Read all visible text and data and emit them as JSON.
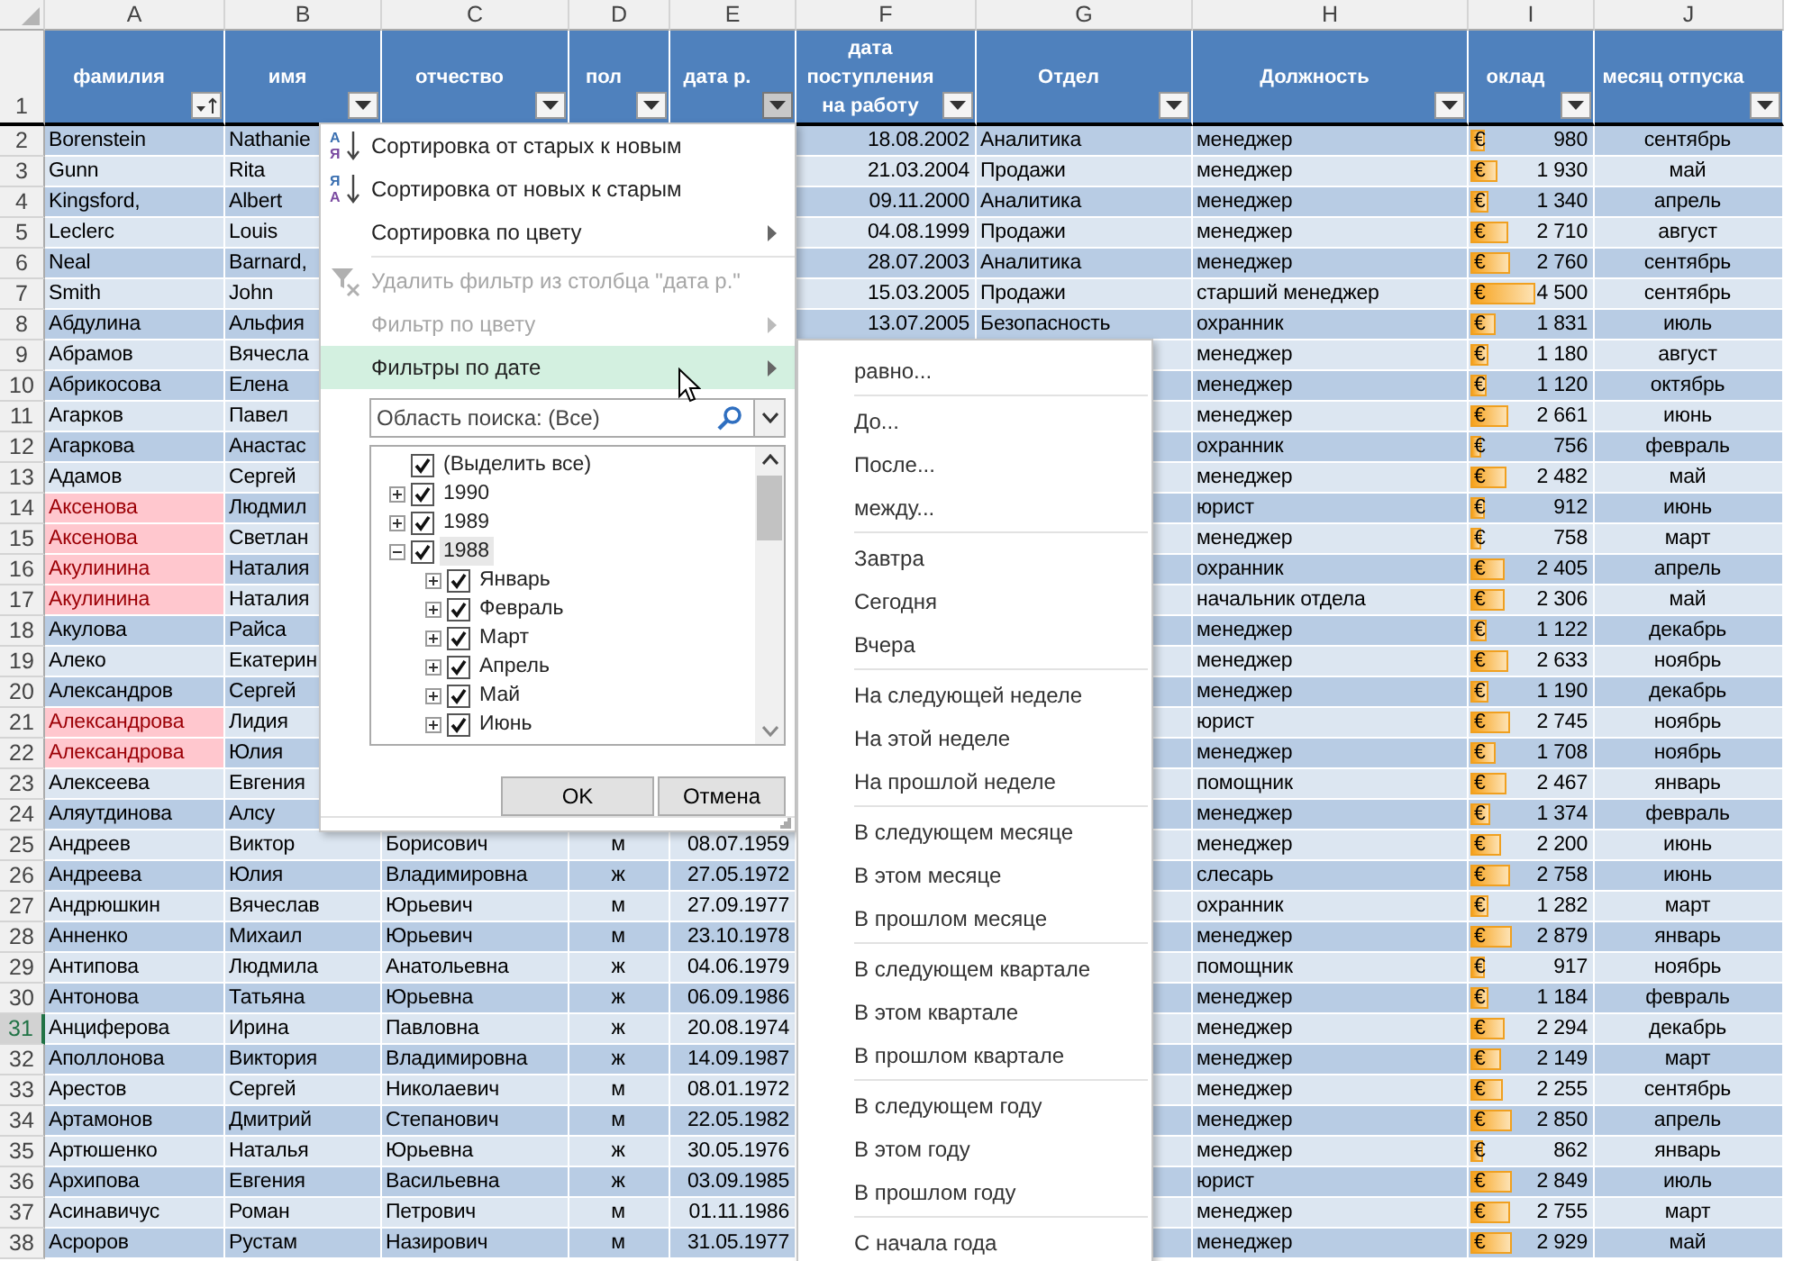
{
  "columns": [
    {
      "letter": "A",
      "header": "фамилия",
      "sorted": true,
      "open": false
    },
    {
      "letter": "B",
      "header": "имя",
      "sorted": false,
      "open": false
    },
    {
      "letter": "C",
      "header": "отчество",
      "sorted": false,
      "open": false
    },
    {
      "letter": "D",
      "header": "пол",
      "sorted": false,
      "open": false
    },
    {
      "letter": "E",
      "header": "дата р.",
      "sorted": false,
      "open": true
    },
    {
      "letter": "F",
      "header": "дата поступления на работу",
      "sorted": false,
      "open": false
    },
    {
      "letter": "G",
      "header": "Отдел",
      "sorted": false,
      "open": false
    },
    {
      "letter": "H",
      "header": "Должность",
      "sorted": false,
      "open": false
    },
    {
      "letter": "I",
      "header": "оклад",
      "sorted": false,
      "open": false
    },
    {
      "letter": "J",
      "header": "месяц отпуска",
      "sorted": false,
      "open": false
    }
  ],
  "header_row_number": "1",
  "rows": [
    {
      "number": "2",
      "active": false,
      "cells": {
        "surname": {
          "text": "Borenstein",
          "highlighted": false
        },
        "name": "Nathanie",
        "hire_date": "18.08.2002",
        "department": "Аналитика",
        "position": "менеджер",
        "salary": {
          "currency": "€",
          "amount": "980",
          "level": 0.11
        },
        "vacation_month": "сентябрь"
      }
    },
    {
      "number": "3",
      "active": false,
      "cells": {
        "surname": {
          "text": "Gunn",
          "highlighted": false
        },
        "name": "Rita",
        "hire_date": "21.03.2004",
        "department": "Продажи",
        "position": "менеджер",
        "salary": {
          "currency": "€",
          "amount": "1 930",
          "level": 0.22
        },
        "vacation_month": "май"
      }
    },
    {
      "number": "4",
      "active": false,
      "cells": {
        "surname": {
          "text": "Kingsford,",
          "highlighted": false
        },
        "name": "Albert",
        "hire_date": "09.11.2000",
        "department": "Аналитика",
        "position": "менеджер",
        "salary": {
          "currency": "€",
          "amount": "1 340",
          "level": 0.15
        },
        "vacation_month": "апрель"
      }
    },
    {
      "number": "5",
      "active": false,
      "cells": {
        "surname": {
          "text": "Leclerc",
          "highlighted": false
        },
        "name": "Louis",
        "hire_date": "04.08.1999",
        "department": "Продажи",
        "position": "менеджер",
        "salary": {
          "currency": "€",
          "amount": "2 710",
          "level": 0.31
        },
        "vacation_month": "август"
      }
    },
    {
      "number": "6",
      "active": false,
      "cells": {
        "surname": {
          "text": "Neal",
          "highlighted": false
        },
        "name": "Barnard,",
        "hire_date": "28.07.2003",
        "department": "Аналитика",
        "position": "менеджер",
        "salary": {
          "currency": "€",
          "amount": "2 760",
          "level": 0.32
        },
        "vacation_month": "сентябрь"
      }
    },
    {
      "number": "7",
      "active": false,
      "cells": {
        "surname": {
          "text": "Smith",
          "highlighted": false
        },
        "name": "John",
        "hire_date": "15.03.2005",
        "department": "Продажи",
        "position": "старший менеджер",
        "salary": {
          "currency": "€",
          "amount": "4 500",
          "level": 0.52
        },
        "vacation_month": "сентябрь"
      }
    },
    {
      "number": "8",
      "active": false,
      "cells": {
        "surname": {
          "text": "Абдулина",
          "highlighted": false
        },
        "name": "Альфия",
        "hire_date": "13.07.2005",
        "department": "Безопасность",
        "position": "охранник",
        "salary": {
          "currency": "€",
          "amount": "1 831",
          "level": 0.21
        },
        "vacation_month": "июль"
      }
    },
    {
      "number": "9",
      "active": false,
      "cells": {
        "surname": {
          "text": "Абрамов",
          "highlighted": false
        },
        "name": "Вячесла",
        "position": "менеджер",
        "salary": {
          "currency": "€",
          "amount": "1 180",
          "level": 0.14
        },
        "vacation_month": "август"
      }
    },
    {
      "number": "10",
      "active": false,
      "cells": {
        "surname": {
          "text": "Абрикосова",
          "highlighted": false
        },
        "name": "Елена",
        "position": "менеджер",
        "salary": {
          "currency": "€",
          "amount": "1 120",
          "level": 0.13
        },
        "vacation_month": "октябрь"
      }
    },
    {
      "number": "11",
      "active": false,
      "cells": {
        "surname": {
          "text": "Агарков",
          "highlighted": false
        },
        "name": "Павел",
        "position": "менеджер",
        "salary": {
          "currency": "€",
          "amount": "2 661",
          "level": 0.31
        },
        "vacation_month": "июнь"
      }
    },
    {
      "number": "12",
      "active": false,
      "cells": {
        "surname": {
          "text": "Агаркова",
          "highlighted": false
        },
        "name": "Анастас",
        "position": "охранник",
        "salary": {
          "currency": "€",
          "amount": "756",
          "level": 0.09
        },
        "vacation_month": "февраль"
      }
    },
    {
      "number": "13",
      "active": false,
      "cells": {
        "surname": {
          "text": "Адамов",
          "highlighted": false
        },
        "name": "Сергей",
        "position": "менеджер",
        "salary": {
          "currency": "€",
          "amount": "2 482",
          "level": 0.29
        },
        "vacation_month": "май"
      }
    },
    {
      "number": "14",
      "active": false,
      "cells": {
        "surname": {
          "text": "Аксенова",
          "highlighted": true
        },
        "name": "Людмил",
        "position": "юрист",
        "salary": {
          "currency": "€",
          "amount": "912",
          "level": 0.11
        },
        "vacation_month": "июнь"
      }
    },
    {
      "number": "15",
      "active": false,
      "cells": {
        "surname": {
          "text": "Аксенова",
          "highlighted": true
        },
        "name": "Светлан",
        "position": "менеджер",
        "salary": {
          "currency": "€",
          "amount": "758",
          "level": 0.09
        },
        "vacation_month": "март"
      }
    },
    {
      "number": "16",
      "active": false,
      "cells": {
        "surname": {
          "text": "Акулинина",
          "highlighted": true
        },
        "name": "Наталия",
        "position": "охранник",
        "salary": {
          "currency": "€",
          "amount": "2 405",
          "level": 0.28
        },
        "vacation_month": "апрель"
      }
    },
    {
      "number": "17",
      "active": false,
      "cells": {
        "surname": {
          "text": "Акулинина",
          "highlighted": true
        },
        "name": "Наталия",
        "position": "начальник отдела",
        "salary": {
          "currency": "€",
          "amount": "2 306",
          "level": 0.27
        },
        "vacation_month": "май"
      }
    },
    {
      "number": "18",
      "active": false,
      "cells": {
        "surname": {
          "text": "Акулова",
          "highlighted": false
        },
        "name": "Райса",
        "position": "менеджер",
        "salary": {
          "currency": "€",
          "amount": "1 122",
          "level": 0.13
        },
        "vacation_month": "декабрь"
      }
    },
    {
      "number": "19",
      "active": false,
      "cells": {
        "surname": {
          "text": "Алеко",
          "highlighted": false
        },
        "name": "Екатерин",
        "position": "менеджер",
        "salary": {
          "currency": "€",
          "amount": "2 633",
          "level": 0.3
        },
        "vacation_month": "ноябрь"
      }
    },
    {
      "number": "20",
      "active": false,
      "cells": {
        "surname": {
          "text": "Александров",
          "highlighted": false
        },
        "name": "Сергей",
        "position": "менеджер",
        "salary": {
          "currency": "€",
          "amount": "1 190",
          "level": 0.14
        },
        "vacation_month": "декабрь"
      }
    },
    {
      "number": "21",
      "active": false,
      "cells": {
        "surname": {
          "text": "Александрова",
          "highlighted": true
        },
        "name": "Лидия",
        "position": "юрист",
        "salary": {
          "currency": "€",
          "amount": "2 745",
          "level": 0.32
        },
        "vacation_month": "ноябрь"
      }
    },
    {
      "number": "22",
      "active": false,
      "cells": {
        "surname": {
          "text": "Александрова",
          "highlighted": true
        },
        "name": "Юлия",
        "position": "менеджер",
        "salary": {
          "currency": "€",
          "amount": "1 708",
          "level": 0.2
        },
        "vacation_month": "ноябрь"
      }
    },
    {
      "number": "23",
      "active": false,
      "cells": {
        "surname": {
          "text": "Алексеева",
          "highlighted": false
        },
        "name": "Евгения",
        "position": "помощник",
        "salary": {
          "currency": "€",
          "amount": "2 467",
          "level": 0.29
        },
        "vacation_month": "январь"
      }
    },
    {
      "number": "24",
      "active": false,
      "cells": {
        "surname": {
          "text": "Аляутдинова",
          "highlighted": false
        },
        "name": "Алсу",
        "position": "менеджер",
        "salary": {
          "currency": "€",
          "amount": "1 374",
          "level": 0.16
        },
        "vacation_month": "февраль"
      }
    },
    {
      "number": "25",
      "active": false,
      "cells": {
        "surname": {
          "text": "Андреев",
          "highlighted": false
        },
        "name": "Виктор",
        "patronymic": "Борисович",
        "gender": "м",
        "birth_date": "08.07.1959",
        "position": "менеджер",
        "salary": {
          "currency": "€",
          "amount": "2 200",
          "level": 0.25
        },
        "vacation_month": "июнь"
      }
    },
    {
      "number": "26",
      "active": false,
      "cells": {
        "surname": {
          "text": "Андреева",
          "highlighted": false
        },
        "name": "Юлия",
        "patronymic": "Владимировна",
        "gender": "ж",
        "birth_date": "27.05.1972",
        "position": "слесарь",
        "salary": {
          "currency": "€",
          "amount": "2 758",
          "level": 0.32
        },
        "vacation_month": "июнь"
      }
    },
    {
      "number": "27",
      "active": false,
      "cells": {
        "surname": {
          "text": "Андрюшкин",
          "highlighted": false
        },
        "name": "Вячеслав",
        "patronymic": "Юрьевич",
        "gender": "м",
        "birth_date": "27.09.1977",
        "position": "охранник",
        "salary": {
          "currency": "€",
          "amount": "1 282",
          "level": 0.15
        },
        "vacation_month": "март"
      }
    },
    {
      "number": "28",
      "active": false,
      "cells": {
        "surname": {
          "text": "Анненко",
          "highlighted": false
        },
        "name": "Михаил",
        "patronymic": "Юрьевич",
        "gender": "м",
        "birth_date": "23.10.1978",
        "position": "менеджер",
        "salary": {
          "currency": "€",
          "amount": "2 879",
          "level": 0.33
        },
        "vacation_month": "январь"
      }
    },
    {
      "number": "29",
      "active": false,
      "cells": {
        "surname": {
          "text": "Антипова",
          "highlighted": false
        },
        "name": "Людмила",
        "patronymic": "Анатольевна",
        "gender": "ж",
        "birth_date": "04.06.1979",
        "position": "помощник",
        "salary": {
          "currency": "€",
          "amount": "917",
          "level": 0.11
        },
        "vacation_month": "ноябрь"
      }
    },
    {
      "number": "30",
      "active": false,
      "cells": {
        "surname": {
          "text": "Антонова",
          "highlighted": false
        },
        "name": "Татьяна",
        "patronymic": "Юрьевна",
        "gender": "ж",
        "birth_date": "06.09.1986",
        "position": "менеджер",
        "salary": {
          "currency": "€",
          "amount": "1 184",
          "level": 0.14
        },
        "vacation_month": "февраль"
      }
    },
    {
      "number": "31",
      "active": true,
      "cells": {
        "surname": {
          "text": "Анциферова",
          "highlighted": false
        },
        "name": "Ирина",
        "patronymic": "Павловна",
        "gender": "ж",
        "birth_date": "20.08.1974",
        "position": "менеджер",
        "salary": {
          "currency": "€",
          "amount": "2 294",
          "level": 0.27
        },
        "vacation_month": "декабрь"
      }
    },
    {
      "number": "32",
      "active": false,
      "cells": {
        "surname": {
          "text": "Аполлонова",
          "highlighted": false
        },
        "name": "Виктория",
        "patronymic": "Владимировна",
        "gender": "ж",
        "birth_date": "14.09.1987",
        "position": "менеджер",
        "salary": {
          "currency": "€",
          "amount": "2 149",
          "level": 0.25
        },
        "vacation_month": "март"
      }
    },
    {
      "number": "33",
      "active": false,
      "cells": {
        "surname": {
          "text": "Арестов",
          "highlighted": false
        },
        "name": "Сергей",
        "patronymic": "Николаевич",
        "gender": "м",
        "birth_date": "08.01.1972",
        "position": "менеджер",
        "salary": {
          "currency": "€",
          "amount": "2 255",
          "level": 0.26
        },
        "vacation_month": "сентябрь"
      }
    },
    {
      "number": "34",
      "active": false,
      "cells": {
        "surname": {
          "text": "Артамонов",
          "highlighted": false
        },
        "name": "Дмитрий",
        "patronymic": "Степанович",
        "gender": "м",
        "birth_date": "22.05.1982",
        "position": "менеджер",
        "salary": {
          "currency": "€",
          "amount": "2 850",
          "level": 0.33
        },
        "vacation_month": "апрель"
      }
    },
    {
      "number": "35",
      "active": false,
      "cells": {
        "surname": {
          "text": "Артюшенко",
          "highlighted": false
        },
        "name": "Наталья",
        "patronymic": "Юрьевна",
        "gender": "ж",
        "birth_date": "30.05.1976",
        "position": "менеджер",
        "salary": {
          "currency": "€",
          "amount": "862",
          "level": 0.1
        },
        "vacation_month": "январь"
      }
    },
    {
      "number": "36",
      "active": false,
      "cells": {
        "surname": {
          "text": "Архипова",
          "highlighted": false
        },
        "name": "Евгения",
        "patronymic": "Васильевна",
        "gender": "ж",
        "birth_date": "03.09.1985",
        "position": "юрист",
        "salary": {
          "currency": "€",
          "amount": "2 849",
          "level": 0.33
        },
        "vacation_month": "июль"
      }
    },
    {
      "number": "37",
      "active": false,
      "cells": {
        "surname": {
          "text": "Асинавичус",
          "highlighted": false
        },
        "name": "Роман",
        "patronymic": "Петрович",
        "gender": "м",
        "birth_date": "01.11.1986",
        "position": "менеджер",
        "salary": {
          "currency": "€",
          "amount": "2 755",
          "level": 0.32
        },
        "vacation_month": "март"
      }
    },
    {
      "number": "38",
      "active": false,
      "cells": {
        "surname": {
          "text": "Асроров",
          "highlighted": false
        },
        "name": "Рустам",
        "patronymic": "Назирович",
        "gender": "м",
        "birth_date": "31.05.1977",
        "position": "менеджер",
        "salary": {
          "currency": "€",
          "amount": "2 929",
          "level": 0.34
        },
        "vacation_month": "май"
      }
    }
  ],
  "filter_menu": {
    "items": [
      {
        "label": "Сортировка от старых к новым",
        "icon": {
          "kind": "sort",
          "top": "А",
          "bottom": "Я"
        },
        "disabled": false,
        "highlighted": false,
        "has_submenu": false,
        "separator_before": false
      },
      {
        "label": "Сортировка от новых к старым",
        "icon": {
          "kind": "sort",
          "top": "Я",
          "bottom": "А"
        },
        "disabled": false,
        "highlighted": false,
        "has_submenu": false,
        "separator_before": false
      },
      {
        "label": "Сортировка по цвету",
        "disabled": false,
        "highlighted": false,
        "has_submenu": true,
        "separator_before": false
      },
      {
        "label": "Удалить фильтр из столбца \"дата р.\"",
        "icon": {
          "kind": "clear_filter"
        },
        "disabled": true,
        "highlighted": false,
        "has_submenu": false,
        "separator_before": true
      },
      {
        "label": "Фильтр по цвету",
        "disabled": true,
        "highlighted": false,
        "has_submenu": true,
        "separator_before": false
      },
      {
        "label": "Фильтры по дате",
        "disabled": false,
        "highlighted": true,
        "has_submenu": true,
        "separator_before": false
      }
    ],
    "search": {
      "placeholder": "Область поиска: (Все)"
    },
    "tree": [
      {
        "label": "(Выделить все)",
        "checked": true,
        "selected": false
      },
      {
        "label": "1990",
        "checked": true,
        "selected": false,
        "expanded": false
      },
      {
        "label": "1989",
        "checked": true,
        "selected": false,
        "expanded": false
      },
      {
        "label": "1988",
        "checked": true,
        "selected": true,
        "expanded": true,
        "children": [
          {
            "label": "Январь",
            "checked": true,
            "selected": false,
            "expanded": false
          },
          {
            "label": "Февраль",
            "checked": true,
            "selected": false,
            "expanded": false
          },
          {
            "label": "Март",
            "checked": true,
            "selected": false,
            "expanded": false
          },
          {
            "label": "Апрель",
            "checked": true,
            "selected": false,
            "expanded": false
          },
          {
            "label": "Май",
            "checked": true,
            "selected": false,
            "expanded": false
          },
          {
            "label": "Июнь",
            "checked": true,
            "selected": false,
            "expanded": false
          }
        ]
      }
    ],
    "buttons": [
      "OK",
      "Отмена"
    ]
  },
  "date_filter_menu": {
    "items": [
      {
        "label": "равно...",
        "separator_before": false
      },
      {
        "label": "До...",
        "separator_before": true
      },
      {
        "label": "После...",
        "separator_before": false
      },
      {
        "label": "между...",
        "separator_before": false
      },
      {
        "label": "Завтра",
        "separator_before": true
      },
      {
        "label": "Сегодня",
        "separator_before": false
      },
      {
        "label": "Вчера",
        "separator_before": false
      },
      {
        "label": "На следующей неделе",
        "separator_before": true
      },
      {
        "label": "На этой неделе",
        "separator_before": false
      },
      {
        "label": "На прошлой неделе",
        "separator_before": false
      },
      {
        "label": "В следующем месяце",
        "separator_before": true
      },
      {
        "label": "В этом месяце",
        "separator_before": false
      },
      {
        "label": "В прошлом месяце",
        "separator_before": false
      },
      {
        "label": "В следующем квартале",
        "separator_before": true
      },
      {
        "label": "В этом квартале",
        "separator_before": false
      },
      {
        "label": "В прошлом квартале",
        "separator_before": false
      },
      {
        "label": "В следующем году",
        "separator_before": true
      },
      {
        "label": "В этом году",
        "separator_before": false
      },
      {
        "label": "В прошлом году",
        "separator_before": false
      },
      {
        "label": "С начала года",
        "separator_before": true
      }
    ]
  }
}
